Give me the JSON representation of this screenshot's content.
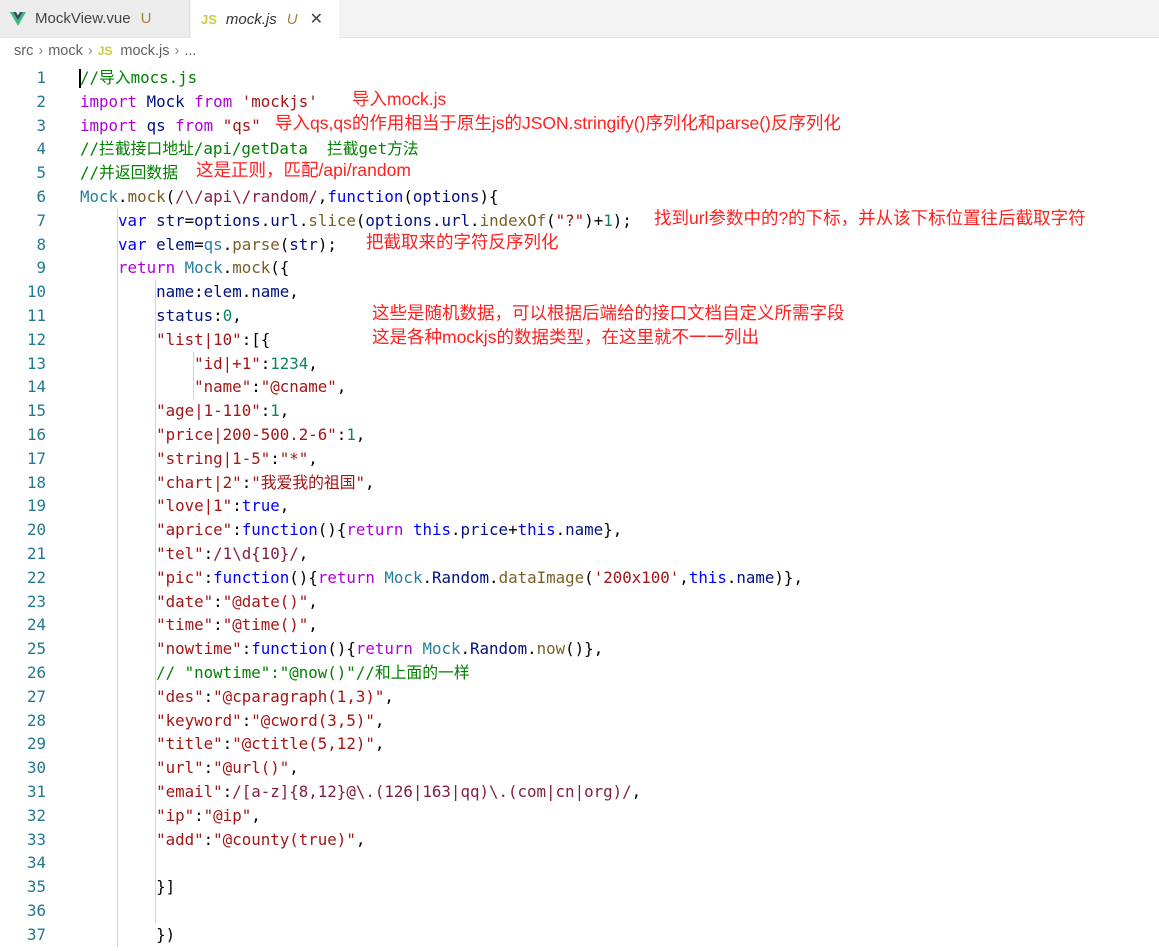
{
  "tabs": [
    {
      "name": "MockView.vue",
      "status": "U",
      "icon": "vue-icon"
    },
    {
      "name": "mock.js",
      "status": "U",
      "icon": "js-icon",
      "badge": "JS",
      "close": "✕"
    }
  ],
  "breadcrumb": {
    "parts": [
      "src",
      "mock",
      "mock.js",
      "..."
    ],
    "badge": "JS"
  },
  "lines": [
    "1",
    "2",
    "3",
    "4",
    "5",
    "6",
    "7",
    "8",
    "9",
    "10",
    "11",
    "12",
    "13",
    "14",
    "15",
    "16",
    "17",
    "18",
    "19",
    "20",
    "21",
    "22",
    "23",
    "24",
    "25",
    "26",
    "27",
    "28",
    "29",
    "30",
    "31",
    "32",
    "33",
    "34",
    "35",
    "36",
    "37"
  ],
  "code": [
    [
      [
        "//导入mocs.js",
        "cm"
      ]
    ],
    [
      [
        "import",
        "kw"
      ],
      [
        " ",
        "p"
      ],
      [
        "Mock",
        "id"
      ],
      [
        " ",
        "p"
      ],
      [
        "from",
        "kw"
      ],
      [
        " ",
        "p"
      ],
      [
        "'mockjs'",
        "str"
      ]
    ],
    [
      [
        "import",
        "kw"
      ],
      [
        " ",
        "p"
      ],
      [
        "qs",
        "id"
      ],
      [
        " ",
        "p"
      ],
      [
        "from",
        "kw"
      ],
      [
        " ",
        "p"
      ],
      [
        "\"qs\"",
        "str"
      ]
    ],
    [
      [
        "//拦截接口地址/api/getData  拦截get方法",
        "cm"
      ]
    ],
    [
      [
        "//并返回数据",
        "cm"
      ]
    ],
    [
      [
        "Mock",
        "cls"
      ],
      [
        ".",
        "p"
      ],
      [
        "mock",
        "fn"
      ],
      [
        "(",
        "p"
      ],
      [
        "/\\/api\\/random/",
        "re"
      ],
      [
        ",",
        "p"
      ],
      [
        "function",
        "bl"
      ],
      [
        "(",
        "p"
      ],
      [
        "options",
        "id"
      ],
      [
        "){",
        "p"
      ]
    ],
    [
      [
        "    ",
        "p"
      ],
      [
        "var",
        "bl"
      ],
      [
        " ",
        "p"
      ],
      [
        "str",
        "id"
      ],
      [
        "=",
        "p"
      ],
      [
        "options",
        "id"
      ],
      [
        ".",
        "p"
      ],
      [
        "url",
        "id"
      ],
      [
        ".",
        "p"
      ],
      [
        "slice",
        "fn"
      ],
      [
        "(",
        "p"
      ],
      [
        "options",
        "id"
      ],
      [
        ".",
        "p"
      ],
      [
        "url",
        "id"
      ],
      [
        ".",
        "p"
      ],
      [
        "indexOf",
        "fn"
      ],
      [
        "(",
        "p"
      ],
      [
        "\"?\"",
        "str"
      ],
      [
        ")+",
        "p"
      ],
      [
        "1",
        "num"
      ],
      [
        ");",
        "p"
      ]
    ],
    [
      [
        "    ",
        "p"
      ],
      [
        "var",
        "bl"
      ],
      [
        " ",
        "p"
      ],
      [
        "elem",
        "id"
      ],
      [
        "=",
        "p"
      ],
      [
        "qs",
        "cls"
      ],
      [
        ".",
        "p"
      ],
      [
        "parse",
        "fn"
      ],
      [
        "(",
        "p"
      ],
      [
        "str",
        "id"
      ],
      [
        ");",
        "p"
      ]
    ],
    [
      [
        "    ",
        "p"
      ],
      [
        "return",
        "kw"
      ],
      [
        " ",
        "p"
      ],
      [
        "Mock",
        "cls"
      ],
      [
        ".",
        "p"
      ],
      [
        "mock",
        "fn"
      ],
      [
        "({",
        "p"
      ]
    ],
    [
      [
        "        ",
        "p"
      ],
      [
        "name",
        "id"
      ],
      [
        ":",
        "p"
      ],
      [
        "elem",
        "id"
      ],
      [
        ".",
        "p"
      ],
      [
        "name",
        "id"
      ],
      [
        ",",
        "p"
      ]
    ],
    [
      [
        "        ",
        "p"
      ],
      [
        "status",
        "id"
      ],
      [
        ":",
        "p"
      ],
      [
        "0",
        "num"
      ],
      [
        ",",
        "p"
      ]
    ],
    [
      [
        "        ",
        "p"
      ],
      [
        "\"list|10\"",
        "str"
      ],
      [
        ":[{",
        "p"
      ]
    ],
    [
      [
        "            ",
        "p"
      ],
      [
        "\"id|+1\"",
        "str"
      ],
      [
        ":",
        "p"
      ],
      [
        "1234",
        "num"
      ],
      [
        ",",
        "p"
      ]
    ],
    [
      [
        "            ",
        "p"
      ],
      [
        "\"name\"",
        "str"
      ],
      [
        ":",
        "p"
      ],
      [
        "\"@cname\"",
        "str"
      ],
      [
        ",",
        "p"
      ]
    ],
    [
      [
        "        ",
        "p"
      ],
      [
        "\"age|1-110\"",
        "str"
      ],
      [
        ":",
        "p"
      ],
      [
        "1",
        "num"
      ],
      [
        ",",
        "p"
      ]
    ],
    [
      [
        "        ",
        "p"
      ],
      [
        "\"price|200-500.2-6\"",
        "str"
      ],
      [
        ":",
        "p"
      ],
      [
        "1",
        "num"
      ],
      [
        ",",
        "p"
      ]
    ],
    [
      [
        "        ",
        "p"
      ],
      [
        "\"string|1-5\"",
        "str"
      ],
      [
        ":",
        "p"
      ],
      [
        "\"*\"",
        "str"
      ],
      [
        ",",
        "p"
      ]
    ],
    [
      [
        "        ",
        "p"
      ],
      [
        "\"chart|2\"",
        "str"
      ],
      [
        ":",
        "p"
      ],
      [
        "\"我爱我的祖国\"",
        "str"
      ],
      [
        ",",
        "p"
      ]
    ],
    [
      [
        "        ",
        "p"
      ],
      [
        "\"love|1\"",
        "str"
      ],
      [
        ":",
        "p"
      ],
      [
        "true",
        "bl"
      ],
      [
        ",",
        "p"
      ]
    ],
    [
      [
        "        ",
        "p"
      ],
      [
        "\"aprice\"",
        "str"
      ],
      [
        ":",
        "p"
      ],
      [
        "function",
        "bl"
      ],
      [
        "(){",
        "p"
      ],
      [
        "return",
        "kw"
      ],
      [
        " ",
        "p"
      ],
      [
        "this",
        "bl"
      ],
      [
        ".",
        "p"
      ],
      [
        "price",
        "id"
      ],
      [
        "+",
        "p"
      ],
      [
        "this",
        "bl"
      ],
      [
        ".",
        "p"
      ],
      [
        "name",
        "id"
      ],
      [
        "},",
        "p"
      ]
    ],
    [
      [
        "        ",
        "p"
      ],
      [
        "\"tel\"",
        "str"
      ],
      [
        ":",
        "p"
      ],
      [
        "/1\\d{10}/",
        "re"
      ],
      [
        ",",
        "p"
      ]
    ],
    [
      [
        "        ",
        "p"
      ],
      [
        "\"pic\"",
        "str"
      ],
      [
        ":",
        "p"
      ],
      [
        "function",
        "bl"
      ],
      [
        "(){",
        "p"
      ],
      [
        "return",
        "kw"
      ],
      [
        " ",
        "p"
      ],
      [
        "Mock",
        "cls"
      ],
      [
        ".",
        "p"
      ],
      [
        "Random",
        "id"
      ],
      [
        ".",
        "p"
      ],
      [
        "dataImage",
        "fn"
      ],
      [
        "(",
        "p"
      ],
      [
        "'200x100'",
        "str"
      ],
      [
        ",",
        "p"
      ],
      [
        "this",
        "bl"
      ],
      [
        ".",
        "p"
      ],
      [
        "name",
        "id"
      ],
      [
        ")},",
        "p"
      ]
    ],
    [
      [
        "        ",
        "p"
      ],
      [
        "\"date\"",
        "str"
      ],
      [
        ":",
        "p"
      ],
      [
        "\"@date()\"",
        "str"
      ],
      [
        ",",
        "p"
      ]
    ],
    [
      [
        "        ",
        "p"
      ],
      [
        "\"time\"",
        "str"
      ],
      [
        ":",
        "p"
      ],
      [
        "\"@time()\"",
        "str"
      ],
      [
        ",",
        "p"
      ]
    ],
    [
      [
        "        ",
        "p"
      ],
      [
        "\"nowtime\"",
        "str"
      ],
      [
        ":",
        "p"
      ],
      [
        "function",
        "bl"
      ],
      [
        "(){",
        "p"
      ],
      [
        "return",
        "kw"
      ],
      [
        " ",
        "p"
      ],
      [
        "Mock",
        "cls"
      ],
      [
        ".",
        "p"
      ],
      [
        "Random",
        "id"
      ],
      [
        ".",
        "p"
      ],
      [
        "now",
        "fn"
      ],
      [
        "()},",
        "p"
      ]
    ],
    [
      [
        "        ",
        "p"
      ],
      [
        "// \"nowtime\":\"@now()\"//和上面的一样",
        "cm"
      ]
    ],
    [
      [
        "        ",
        "p"
      ],
      [
        "\"des\"",
        "str"
      ],
      [
        ":",
        "p"
      ],
      [
        "\"@cparagraph(1,3)\"",
        "str"
      ],
      [
        ",",
        "p"
      ]
    ],
    [
      [
        "        ",
        "p"
      ],
      [
        "\"keyword\"",
        "str"
      ],
      [
        ":",
        "p"
      ],
      [
        "\"@cword(3,5)\"",
        "str"
      ],
      [
        ",",
        "p"
      ]
    ],
    [
      [
        "        ",
        "p"
      ],
      [
        "\"title\"",
        "str"
      ],
      [
        ":",
        "p"
      ],
      [
        "\"@ctitle(5,12)\"",
        "str"
      ],
      [
        ",",
        "p"
      ]
    ],
    [
      [
        "        ",
        "p"
      ],
      [
        "\"url\"",
        "str"
      ],
      [
        ":",
        "p"
      ],
      [
        "\"@url()\"",
        "str"
      ],
      [
        ",",
        "p"
      ]
    ],
    [
      [
        "        ",
        "p"
      ],
      [
        "\"email\"",
        "str"
      ],
      [
        ":",
        "p"
      ],
      [
        "/[a-z]{8,12}@\\.(126|163|qq)\\.(com|cn|org)/",
        "re"
      ],
      [
        ",",
        "p"
      ]
    ],
    [
      [
        "        ",
        "p"
      ],
      [
        "\"ip\"",
        "str"
      ],
      [
        ":",
        "p"
      ],
      [
        "\"@ip\"",
        "str"
      ],
      [
        ",",
        "p"
      ]
    ],
    [
      [
        "        ",
        "p"
      ],
      [
        "\"add\"",
        "str"
      ],
      [
        ":",
        "p"
      ],
      [
        "\"@county(true)\"",
        "str"
      ],
      [
        ",",
        "p"
      ]
    ],
    [
      [
        "",
        "p"
      ]
    ],
    [
      [
        "        ",
        "p"
      ],
      [
        "}]",
        "p"
      ]
    ],
    [
      [
        "",
        "p"
      ]
    ],
    [
      [
        "        ",
        "p"
      ],
      [
        "})",
        "p"
      ]
    ]
  ],
  "annotations": [
    {
      "line": 2,
      "text": "导入mock.js"
    },
    {
      "line": 3,
      "text": "导入qs,qs的作用相当于原生js的JSON.stringify()序列化和parse()反序列化"
    },
    {
      "line": 5,
      "text": "这是正则，匹配/api/random"
    },
    {
      "line": 7,
      "text": "找到url参数中的?的下标，并从该下标位置往后截取字符"
    },
    {
      "line": 8,
      "text": "把截取来的字符反序列化"
    },
    {
      "line": 11,
      "text": "这些是随机数据，可以根据后端给的接口文档自定义所需字段"
    },
    {
      "line": 12,
      "text": "这是各种mockjs的数据类型，在这里就不一一列出"
    }
  ],
  "colors": {
    "line_number": "#237893",
    "keyword": "#af00db",
    "string": "#a31515",
    "comment": "#008000",
    "annotation": "#ff2020"
  }
}
